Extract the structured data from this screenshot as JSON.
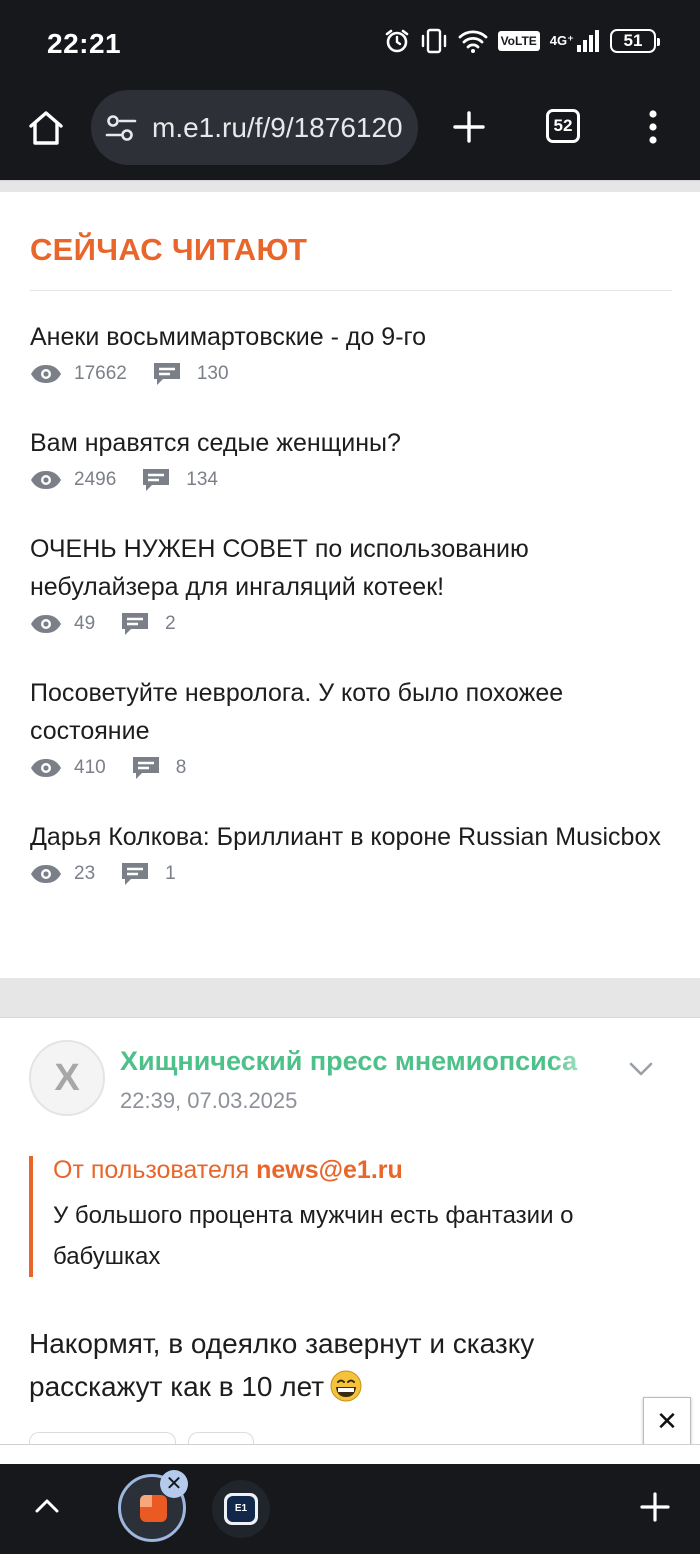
{
  "status_bar": {
    "time": "22:21",
    "network_label": "VoLTE",
    "signal_label": "4G⁺",
    "battery": "51"
  },
  "browser": {
    "url": "m.e1.ru/f/9/1876120",
    "tab_count": "52"
  },
  "reading_now": {
    "heading": "СЕЙЧАС ЧИТАЮТ",
    "items": [
      {
        "title": "Анеки восьмимартовские - до 9-го",
        "views": "17662",
        "comments": "130"
      },
      {
        "title": "Вам нравятся седые женщины?",
        "views": "2496",
        "comments": "134"
      },
      {
        "title": "ОЧЕНЬ НУЖЕН СОВЕТ по использованию небулайзера для ингаляций котеек!",
        "views": "49",
        "comments": "2"
      },
      {
        "title": "Посоветуйте невролога. У кото было похожее состояние",
        "views": "410",
        "comments": "8"
      },
      {
        "title": "Дарья Колкова: Бриллиант в короне Russian Musicbox",
        "views": "23",
        "comments": "1"
      }
    ]
  },
  "post": {
    "avatar_letter": "X",
    "author": "Хищнический пресс мнемиопсиса",
    "date": "22:39, 07.03.2025",
    "quote_prefix": "От пользователя",
    "quote_user": "news@e1.ru",
    "quote_text": "У большого процента мужчин есть фантазии о бабушках",
    "body": "Накормят, в одеялко завернут и сказку расскажут как в 10 лет",
    "close_label": "✕"
  },
  "bottom_tabs": {
    "close_label": "✕",
    "tab2_logo": "E1"
  },
  "colors": {
    "accent_orange": "#e8662a",
    "author_green": "#4ec08a",
    "chrome_dark": "#16181c"
  },
  "icons": [
    "home-icon",
    "site-settings-icon",
    "plus-icon",
    "tab-switcher-icon",
    "more-vert-icon",
    "eye-icon",
    "comment-icon",
    "chevron-down-icon",
    "grin-emoji-icon",
    "chevron-up-icon",
    "close-icon"
  ]
}
